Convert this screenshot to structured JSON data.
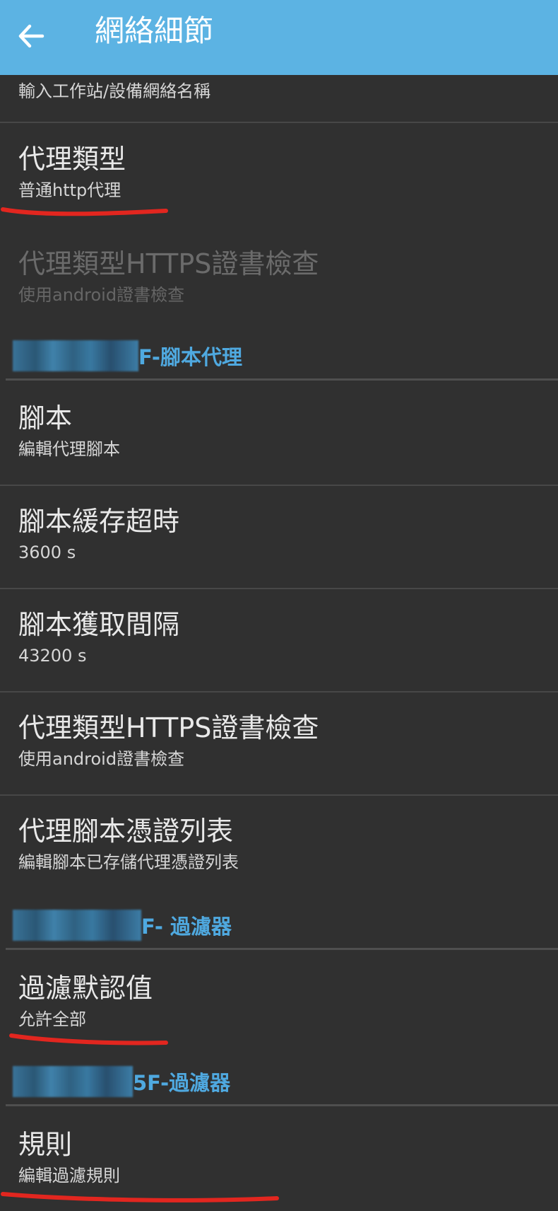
{
  "appbar": {
    "title": "網絡細節",
    "back_icon": "arrow-left-icon"
  },
  "top_partial": {
    "sub": "輸入工作站/設備網絡名稱"
  },
  "items": {
    "proxy_type": {
      "title": "代理類型",
      "sub": "普通http代理"
    },
    "https_check_disabled": {
      "title": "代理類型HTTPS證書檢查",
      "sub": "使用android證書檢查"
    },
    "script": {
      "title": "腳本",
      "sub": "編輯代理腳本"
    },
    "script_cache_timeout": {
      "title": "腳本緩存超時",
      "sub": " 3600 s"
    },
    "script_fetch_interval": {
      "title": "腳本獲取間隔",
      "sub": " 43200 s"
    },
    "https_check": {
      "title": "代理類型HTTPS證書檢查",
      "sub": "使用android證書檢查"
    },
    "credential_list": {
      "title": "代理腳本憑證列表",
      "sub": "編輯腳本已存儲代理憑證列表"
    },
    "filter_default": {
      "title": "過濾默認值",
      "sub": "允許全部"
    },
    "rules": {
      "title": "規則",
      "sub": "編輯過濾規則"
    }
  },
  "sections": {
    "script_proxy": "F-腳本代理",
    "filter": "F- 過濾器",
    "filter2": "5F-過濾器"
  },
  "colors": {
    "appbar": "#5cb3e3",
    "background": "#303030",
    "section_text": "#4fa9e0",
    "annotation": "#e2261f"
  }
}
